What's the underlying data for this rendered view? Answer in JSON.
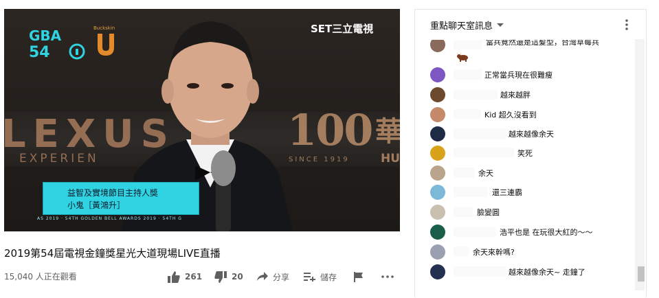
{
  "video": {
    "broadcaster_logo": "SET三立電視",
    "gba_logo": "GBA 54",
    "buckskin_logo": "Buckskin",
    "sponsor_brand": "LEXUS",
    "sponsor_tagline": "EXPERIEN",
    "anniversary_logo": "100",
    "anniversary_since": "SINCE 1919",
    "right_brand": "華",
    "right_brand_sub": "HU",
    "caption_line1": "益智及實境節目主持人獎",
    "caption_line2": "小鬼［黃鴻升］",
    "caption_ticker": "AS 2019 · 54TH GOLDEN BELL AWARDS 2019 · 54TH G"
  },
  "info": {
    "title": "2019第54屆電視金鐘獎星光大道現場LIVE直播",
    "views": "15,040 人正在觀看",
    "like_count": "261",
    "dislike_count": "20",
    "share_label": "分享",
    "save_label": "儲存",
    "icons": [
      "thumb-up-icon",
      "thumb-down-icon",
      "share-icon",
      "save-playlist-icon",
      "flag-icon",
      "more-icon"
    ]
  },
  "chat": {
    "header_title": "重點聊天室訊息",
    "header_icons": [
      "caret-down-icon",
      "kebab-menu-icon"
    ],
    "messages": [
      {
        "text": "當兵竟然還是這髮型，台灣草莓兵",
        "avatar_color": "#8a6a5a"
      },
      {
        "text": "正常當兵現在很難瘦",
        "avatar_color": "#7e57c2"
      },
      {
        "text": "越來越胖",
        "avatar_color": "#6b4a2e"
      },
      {
        "text": "Kid 超久沒看到",
        "avatar_color": "#c58a6a"
      },
      {
        "text": "越來越像余天",
        "avatar_color": "#1f2a44"
      },
      {
        "text": "笑死",
        "avatar_color": "#d9a21b"
      },
      {
        "text": "余天",
        "avatar_color": "#b9a48c"
      },
      {
        "text": "還三連霸",
        "avatar_color": "#7cb8d8"
      },
      {
        "text": "臉變圓",
        "avatar_color": "#c9c0b0"
      },
      {
        "text": "浩平也是 在玩很大紅的～～",
        "avatar_color": "#1b5e4a"
      },
      {
        "text": "余天來幹嗎?",
        "avatar_color": "#9aa0b0"
      },
      {
        "text": "越來越像余天~ 走鐘了",
        "avatar_color": "#23304f"
      }
    ]
  },
  "colors": {
    "caption_bg": "#2fd3e2",
    "lexus_gold": "#a77a5c",
    "text_secondary": "#606060"
  }
}
